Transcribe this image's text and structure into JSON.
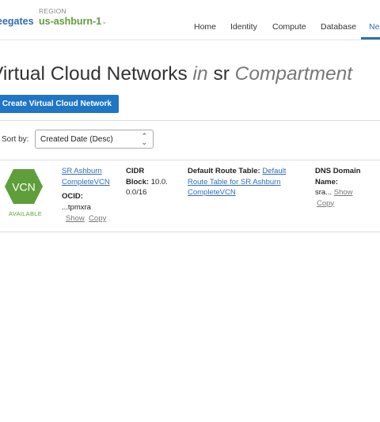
{
  "header": {
    "tenancy": "eegates",
    "region_caption": "REGION",
    "region": "us-ashburn-1",
    "region_caret": "⌄",
    "nav": [
      "Home",
      "Identity",
      "Compute",
      "Database",
      "Ne"
    ]
  },
  "page": {
    "title_part1": "Virtual Cloud Networks",
    "title_in": "in",
    "title_compartment_name": "sr",
    "title_compartment_word": "Compartment",
    "create_button": "Create Virtual Cloud Network",
    "sort_label": "Sort by:",
    "sort_value": "Created Date (Desc)"
  },
  "vcn": {
    "badge": "VCN",
    "status": "AVAILABLE",
    "name_line1": "SR Ashburn",
    "name_line2": "CompleteVCN",
    "ocid_label": "OCID:",
    "ocid_value": "...tpmxra",
    "show": "Show",
    "copy": "Copy",
    "cidr_label_line1": "CIDR",
    "cidr_label_line2": "Block:",
    "cidr_value_part1": "10.0.",
    "cidr_value_part2": "0.0/16",
    "route_label": "Default Route Table:",
    "route_link_part1": "Default",
    "route_link_line2": "Route Table for SR Ashburn",
    "route_link_line3": "CompleteVCN",
    "dns_label_line1": "DNS Domain",
    "dns_label_line2": "Name:",
    "dns_value": "sra..."
  },
  "colors": {
    "brand_blue": "#1f75c6",
    "status_green": "#5f9e3a"
  }
}
